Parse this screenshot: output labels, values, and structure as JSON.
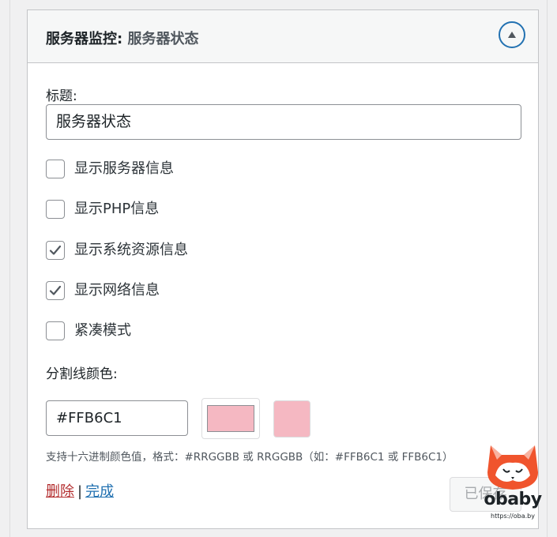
{
  "widget": {
    "title": "服务器监控",
    "separator": ":",
    "subtitle": "服务器状态"
  },
  "form": {
    "title_label": "标题:",
    "title_value": "服务器状态",
    "checkboxes": [
      {
        "label": "显示服务器信息",
        "checked": false
      },
      {
        "label": "显示PHP信息",
        "checked": false
      },
      {
        "label": "显示系统资源信息",
        "checked": true
      },
      {
        "label": "显示网络信息",
        "checked": true
      },
      {
        "label": "紧凑模式",
        "checked": false
      }
    ],
    "color_label": "分割线颜色:",
    "color_value": "#FFB6C1",
    "help_text": "支持十六进制颜色值，格式：#RRGGBB 或 RRGGBB（如：#FFB6C1 或 FFB6C1）"
  },
  "actions": {
    "delete_label": "删除",
    "pipe": "|",
    "done_label": "完成",
    "save_label": "已保存"
  },
  "watermark": {
    "word": "obaby",
    "url": "https://oba.by"
  },
  "colors": {
    "accent": "#2271b1",
    "delete": "#b32d2e",
    "swatch": "#f5b8c2",
    "logo": "#f0542d"
  },
  "icons": {
    "toggle": "triangle-up-icon",
    "check": "checkmark-icon"
  }
}
